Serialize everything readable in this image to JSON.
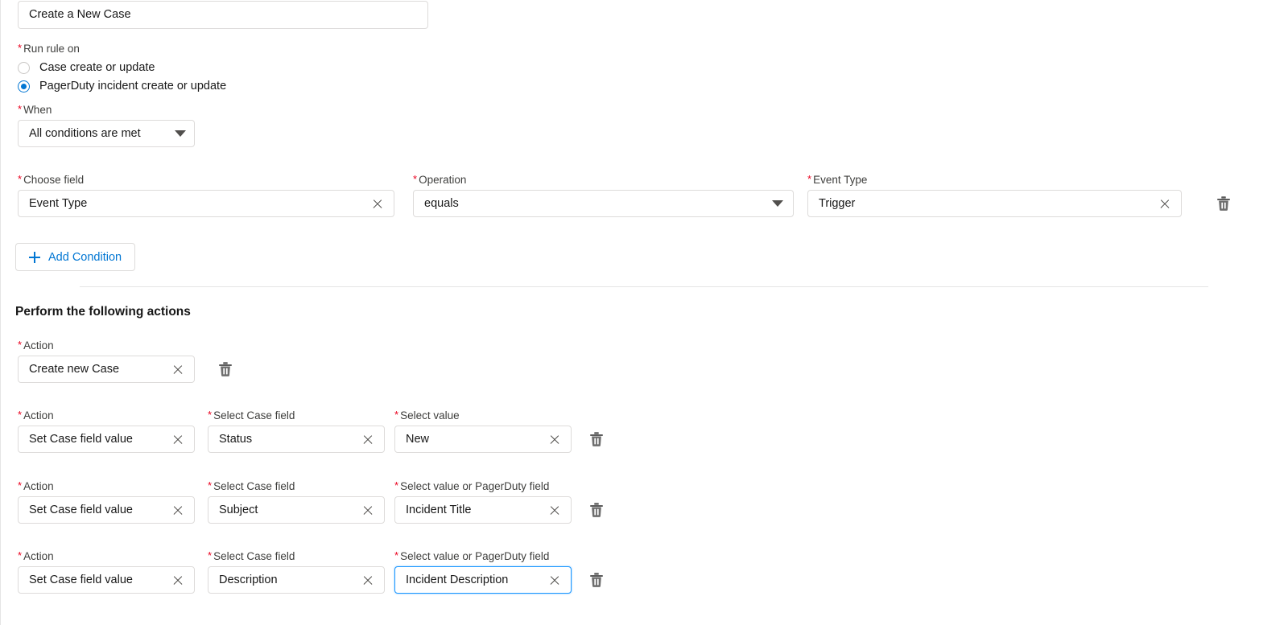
{
  "rule_name": {
    "value": "Create a New Case"
  },
  "run_rule_on": {
    "label": "Run rule on",
    "options": [
      {
        "label": "Case create or update",
        "selected": false
      },
      {
        "label": "PagerDuty incident create or update",
        "selected": true
      }
    ]
  },
  "when": {
    "label": "When",
    "value": "All conditions are met"
  },
  "condition": {
    "field": {
      "label": "Choose field",
      "value": "Event Type"
    },
    "operation": {
      "label": "Operation",
      "value": "equals"
    },
    "event_type": {
      "label": "Event Type",
      "value": "Trigger"
    },
    "delete_icon": "trash-icon"
  },
  "add_condition": {
    "label": "Add Condition",
    "icon": "plus-icon"
  },
  "actions_section": {
    "heading": "Perform the following actions",
    "rows": [
      {
        "action": {
          "label": "Action",
          "value": "Create new Case"
        },
        "case_field": null,
        "value_field": null,
        "delete_icon": "trash-icon"
      },
      {
        "action": {
          "label": "Action",
          "value": "Set Case field value"
        },
        "case_field": {
          "label": "Select Case field",
          "value": "Status"
        },
        "value_field": {
          "label": "Select value",
          "value": "New",
          "focused": false
        },
        "delete_icon": "trash-icon"
      },
      {
        "action": {
          "label": "Action",
          "value": "Set Case field value"
        },
        "case_field": {
          "label": "Select Case field",
          "value": "Subject"
        },
        "value_field": {
          "label": "Select value or PagerDuty field",
          "value": "Incident Title",
          "focused": false
        },
        "delete_icon": "trash-icon"
      },
      {
        "action": {
          "label": "Action",
          "value": "Set Case field value"
        },
        "case_field": {
          "label": "Select Case field",
          "value": "Description"
        },
        "value_field": {
          "label": "Select value or PagerDuty field",
          "value": "Incident Description",
          "focused": true
        },
        "delete_icon": "trash-icon"
      }
    ]
  },
  "icons": {
    "clear": "clear-icon",
    "caret": "chevron-down-icon"
  },
  "colors": {
    "accent_blue": "#0176d3",
    "focus_blue": "#1b96ff",
    "required_red": "#ea001e",
    "border_gray": "#dddbda",
    "text": "#181818"
  }
}
